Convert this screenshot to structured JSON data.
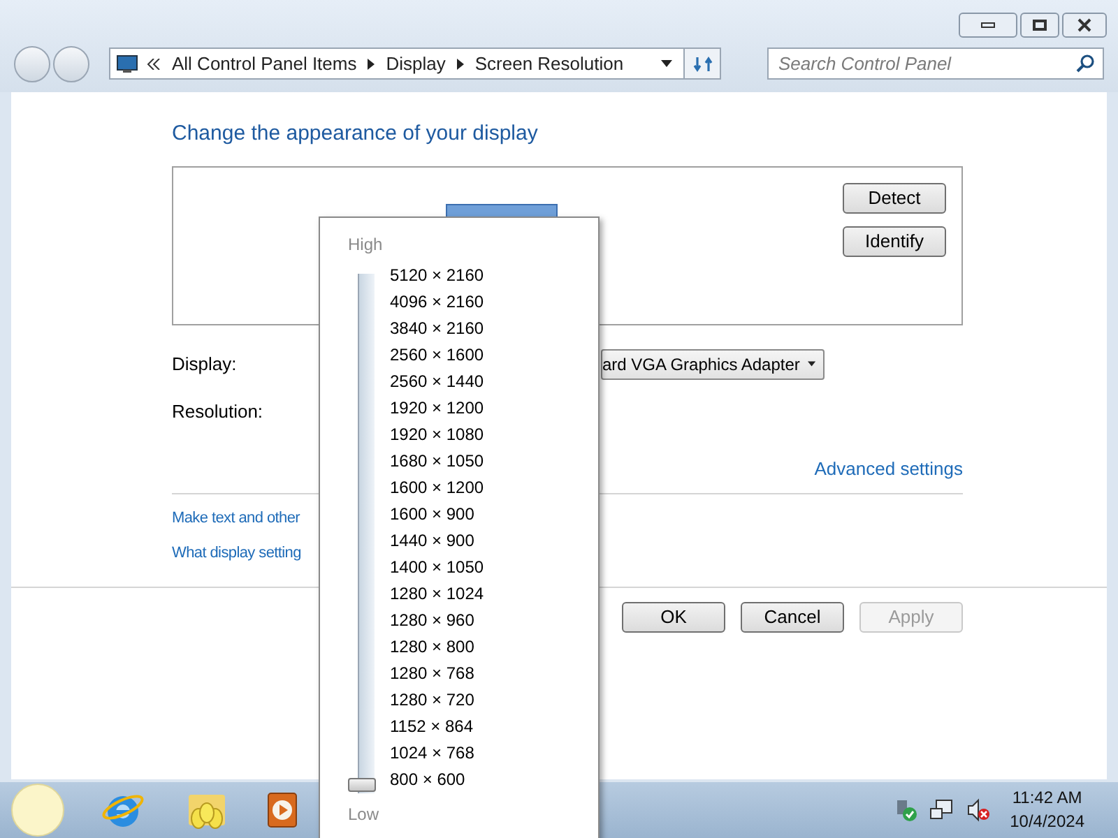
{
  "address_bar": {
    "crumbs": [
      "All Control Panel Items",
      "Display",
      "Screen Resolution"
    ]
  },
  "search": {
    "placeholder": "Search Control Panel"
  },
  "heading": "Change the appearance of your display",
  "preview": {
    "buttons": [
      "Detect",
      "Identify"
    ]
  },
  "display": {
    "label": "Display:",
    "value": "ard VGA Graphics Adapter"
  },
  "resolution": {
    "label": "Resolution:"
  },
  "advanced_link": "Advanced settings",
  "links": [
    "Make text and other",
    "What display setting"
  ],
  "buttons": [
    {
      "label": "OK",
      "disabled": false
    },
    {
      "label": "Cancel",
      "disabled": false
    },
    {
      "label": "Apply",
      "disabled": true
    }
  ],
  "resolution_popup": {
    "high_label": "High",
    "low_label": "Low",
    "level": 0,
    "options": [
      "5120 × 2160",
      "4096 × 2160",
      "3840 × 2160",
      "2560 × 1600",
      "2560 × 1440",
      "1920 × 1200",
      "1920 × 1080",
      "1680 × 1050",
      "1600 × 1200",
      "1600 × 900",
      "1440 × 900",
      "1400 × 1050",
      "1280 × 1024",
      "1280 × 960",
      "1280 × 800",
      "1280 × 768",
      "1280 × 720",
      "1152 × 864",
      "1024 × 768",
      "800 × 600"
    ]
  },
  "taskbar": {
    "time": "11:42 AM",
    "date": "10/4/2024"
  }
}
